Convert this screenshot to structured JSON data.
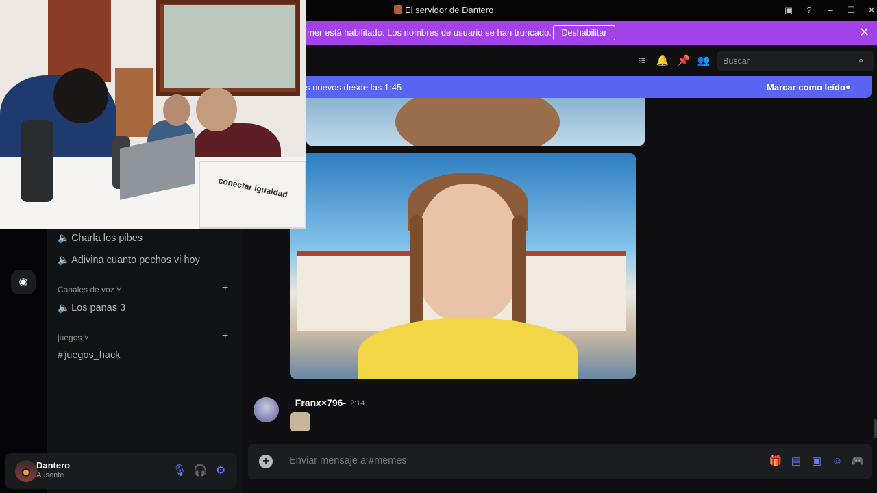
{
  "window": {
    "title": "El servidor de Dantero"
  },
  "banner": {
    "text": "mer está habilitado. Los nombres de usuario se han truncado.",
    "button": "Deshabilitar"
  },
  "header": {
    "search_placeholder": "Buscar"
  },
  "new_messages": {
    "text": "s nuevos desde las 1:45",
    "action": "Marcar como leído"
  },
  "sidebar": {
    "channels": [
      {
        "label": "Charla los pibes",
        "icon": "speaker-icon"
      },
      {
        "label": "Adivina cuanto pechos vi hoy",
        "icon": "speaker-icon"
      }
    ],
    "categories": [
      {
        "label": "Canales de voz",
        "items": [
          {
            "label": "Los panas 3",
            "icon": "speaker-icon"
          }
        ]
      },
      {
        "label": "juegos",
        "items": [
          {
            "label": "juegos_hack",
            "icon": "hash-icon"
          }
        ]
      }
    ],
    "user": {
      "name": "Dantero",
      "status": "Ausente"
    }
  },
  "message": {
    "author": "_Franx×796-",
    "time": "2:14"
  },
  "composer": {
    "placeholder": "Enviar mensaje a #memes"
  },
  "webcam": {
    "sticker_text": "conectar igualdad"
  },
  "colors": {
    "banner": "#a442e9",
    "new_messages": "#5a64f2",
    "accent": "#6b7dff"
  }
}
